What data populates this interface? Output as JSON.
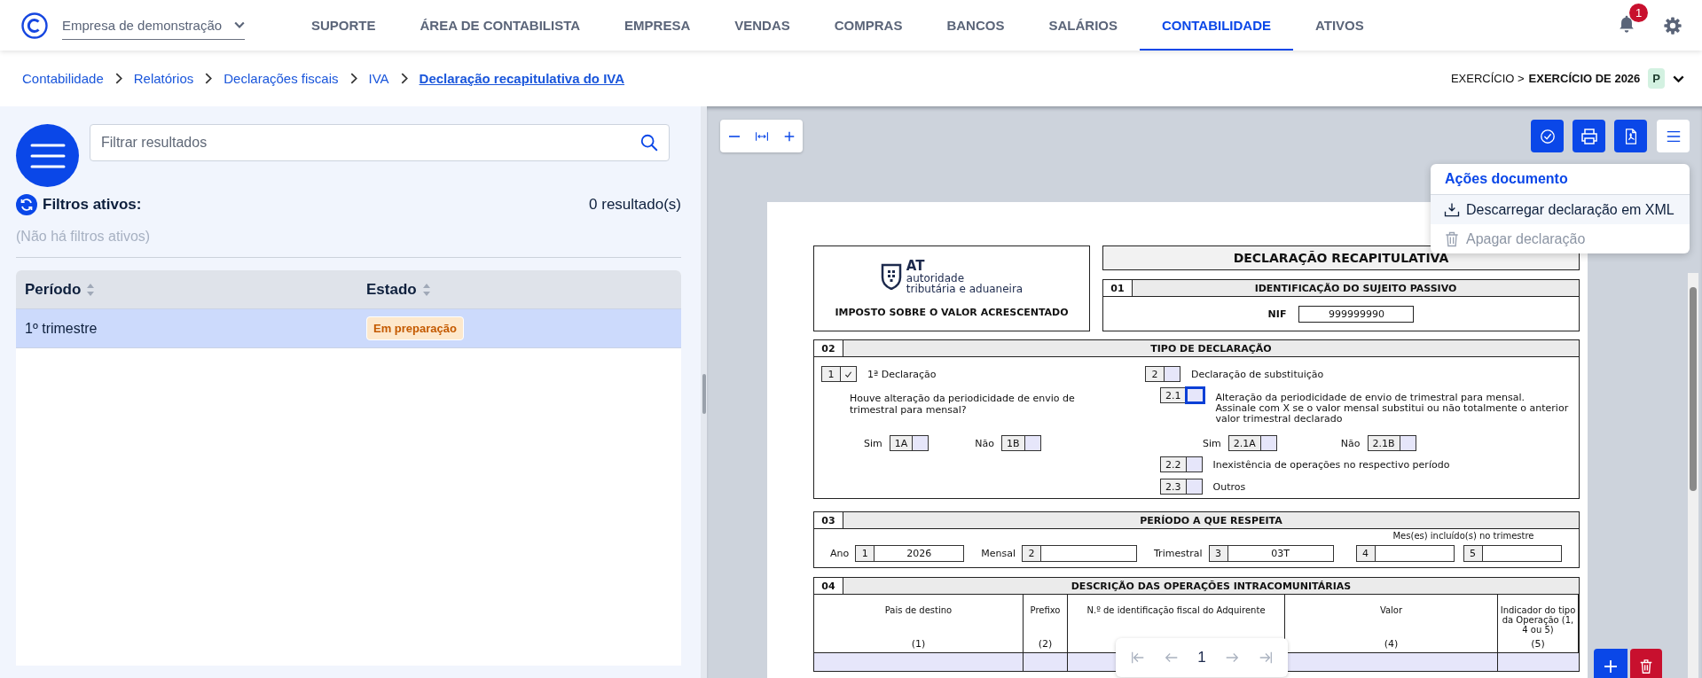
{
  "header": {
    "company": "Empresa de demonstração",
    "notification_count": "1",
    "nav": [
      {
        "label": "SUPORTE",
        "selected": false
      },
      {
        "label": "ÁREA DE CONTABILISTA",
        "selected": false
      },
      {
        "label": "EMPRESA",
        "selected": false
      },
      {
        "label": "VENDAS",
        "selected": false
      },
      {
        "label": "COMPRAS",
        "selected": false
      },
      {
        "label": "BANCOS",
        "selected": false
      },
      {
        "label": "SALÁRIOS",
        "selected": false
      },
      {
        "label": "CONTABILIDADE",
        "selected": true
      },
      {
        "label": "ATIVOS",
        "selected": false
      }
    ]
  },
  "breadcrumb": {
    "items": [
      {
        "label": "Contabilidade",
        "current": false
      },
      {
        "label": "Relatórios",
        "current": false
      },
      {
        "label": "Declarações fiscais",
        "current": false
      },
      {
        "label": "IVA",
        "current": false
      },
      {
        "label": "Declaração recapitulativa do IVA",
        "current": true
      }
    ],
    "fiscal_year_prefix": "EXERCÍCIO >",
    "fiscal_year": "EXERCÍCIO DE 2026",
    "fiscal_year_badge": "P"
  },
  "list": {
    "filter_placeholder": "Filtrar resultados",
    "active_filters": "Filtros ativos:",
    "result_count": "0 resultado(s)",
    "no_filters": "(Não há filtros ativos)",
    "columns": [
      "Período",
      "Estado"
    ],
    "rows": [
      {
        "period": "1º trimestre",
        "status": "Em preparação",
        "selected": true
      }
    ]
  },
  "viewer": {
    "page": "1",
    "actions_menu": {
      "title": "Ações documento",
      "items": [
        {
          "kind": "download",
          "label": "Descarregar declaração em XML",
          "disabled": false
        },
        {
          "kind": "delete",
          "label": "Apagar declaração",
          "disabled": true
        }
      ]
    }
  },
  "document": {
    "logo": {
      "abbr": "AT",
      "line1": "autoridade",
      "line2": "tributária e aduaneira"
    },
    "tax_name": "IMPOSTO SOBRE O VALOR ACRESCENTADO",
    "title": "DECLARAÇÃO RECAPITULATIVA",
    "identification": {
      "number": "01",
      "title": "IDENTIFICAÇÃO DO SUJEITO PASSIVO",
      "nif_label": "NIF",
      "nif": "999999990"
    },
    "declaration_type": {
      "number": "02",
      "title": "TIPO DE DECLARAÇÃO",
      "first": {
        "code": "1",
        "checked": true,
        "label": "1ª Declaração"
      },
      "question": "Houve alteração da periodicidade de envio de trimestral para mensal?",
      "question_options": [
        {
          "label": "Sim",
          "code": "1A",
          "checked": false
        },
        {
          "label": "Não",
          "code": "1B",
          "checked": false
        }
      ],
      "replacement": {
        "code": "2",
        "checked": false,
        "label": "Declaração de substituição"
      },
      "change": {
        "code": "2.1",
        "checked": false,
        "focused": true,
        "lines": [
          "Alteração da periodicidade de envio de trimestral para mensal.",
          "Assinale com X se o valor mensal substitui ou não totalmente o anterior valor trimestral declarado"
        ],
        "options": [
          {
            "label": "Sim",
            "code": "2.1A",
            "checked": false
          },
          {
            "label": "Não",
            "code": "2.1B",
            "checked": false
          }
        ]
      },
      "others": [
        {
          "code": "2.2",
          "checked": false,
          "label": "Inexistência de operações no respectivo período"
        },
        {
          "code": "2.3",
          "checked": false,
          "label": "Outros"
        }
      ]
    },
    "period": {
      "number": "03",
      "title": "PERÍODO A QUE RESPEITA",
      "months_caption": "Mes(es) incluído(s) no trimestre",
      "fields": [
        {
          "label": "Ano",
          "code": "1",
          "value": "2026"
        },
        {
          "label": "Mensal",
          "code": "2"
        },
        {
          "label": "Trimestral",
          "code": "3",
          "value": "03T"
        },
        {
          "code": "4"
        },
        {
          "code": "5"
        }
      ]
    },
    "operations": {
      "number": "04",
      "title": "DESCRIÇÃO DAS OPERAÇÕES INTRACOMUNITÁRIAS",
      "columns": [
        {
          "title": "Pais de destino",
          "index": "(1)"
        },
        {
          "title": "Prefixo",
          "index": "(2)"
        },
        {
          "title": "N.º de identificação fiscal do Adquirente"
        },
        {
          "title": "Valor",
          "index": "(4)"
        },
        {
          "title": "Indicador do tipo da Operação (1, 4 ou 5)",
          "index": "(5)"
        }
      ]
    }
  }
}
